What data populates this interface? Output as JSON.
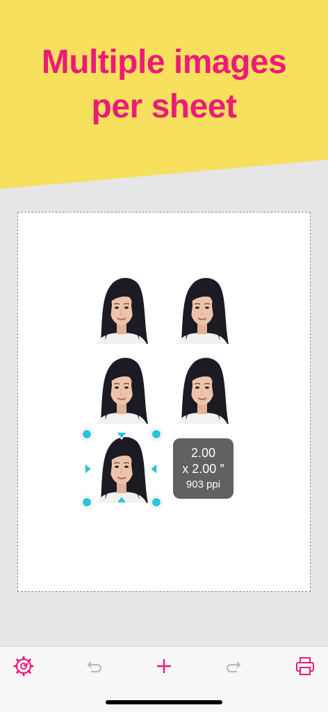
{
  "banner": {
    "title_line1": "Multiple images",
    "title_line2": "per sheet"
  },
  "selection": {
    "size_line1": "2.00",
    "size_line2": "x 2.00 ″",
    "resolution": "903 ppi"
  },
  "toolbar": {
    "settings_icon": "gear-icon",
    "undo_icon": "undo-icon",
    "add_icon": "plus-icon",
    "redo_icon": "redo-icon",
    "print_icon": "printer-icon"
  },
  "colors": {
    "accent": "#e8197a",
    "banner_bg": "#f6e05d",
    "handle": "#2ec4d6",
    "badge_bg": "#616161"
  }
}
